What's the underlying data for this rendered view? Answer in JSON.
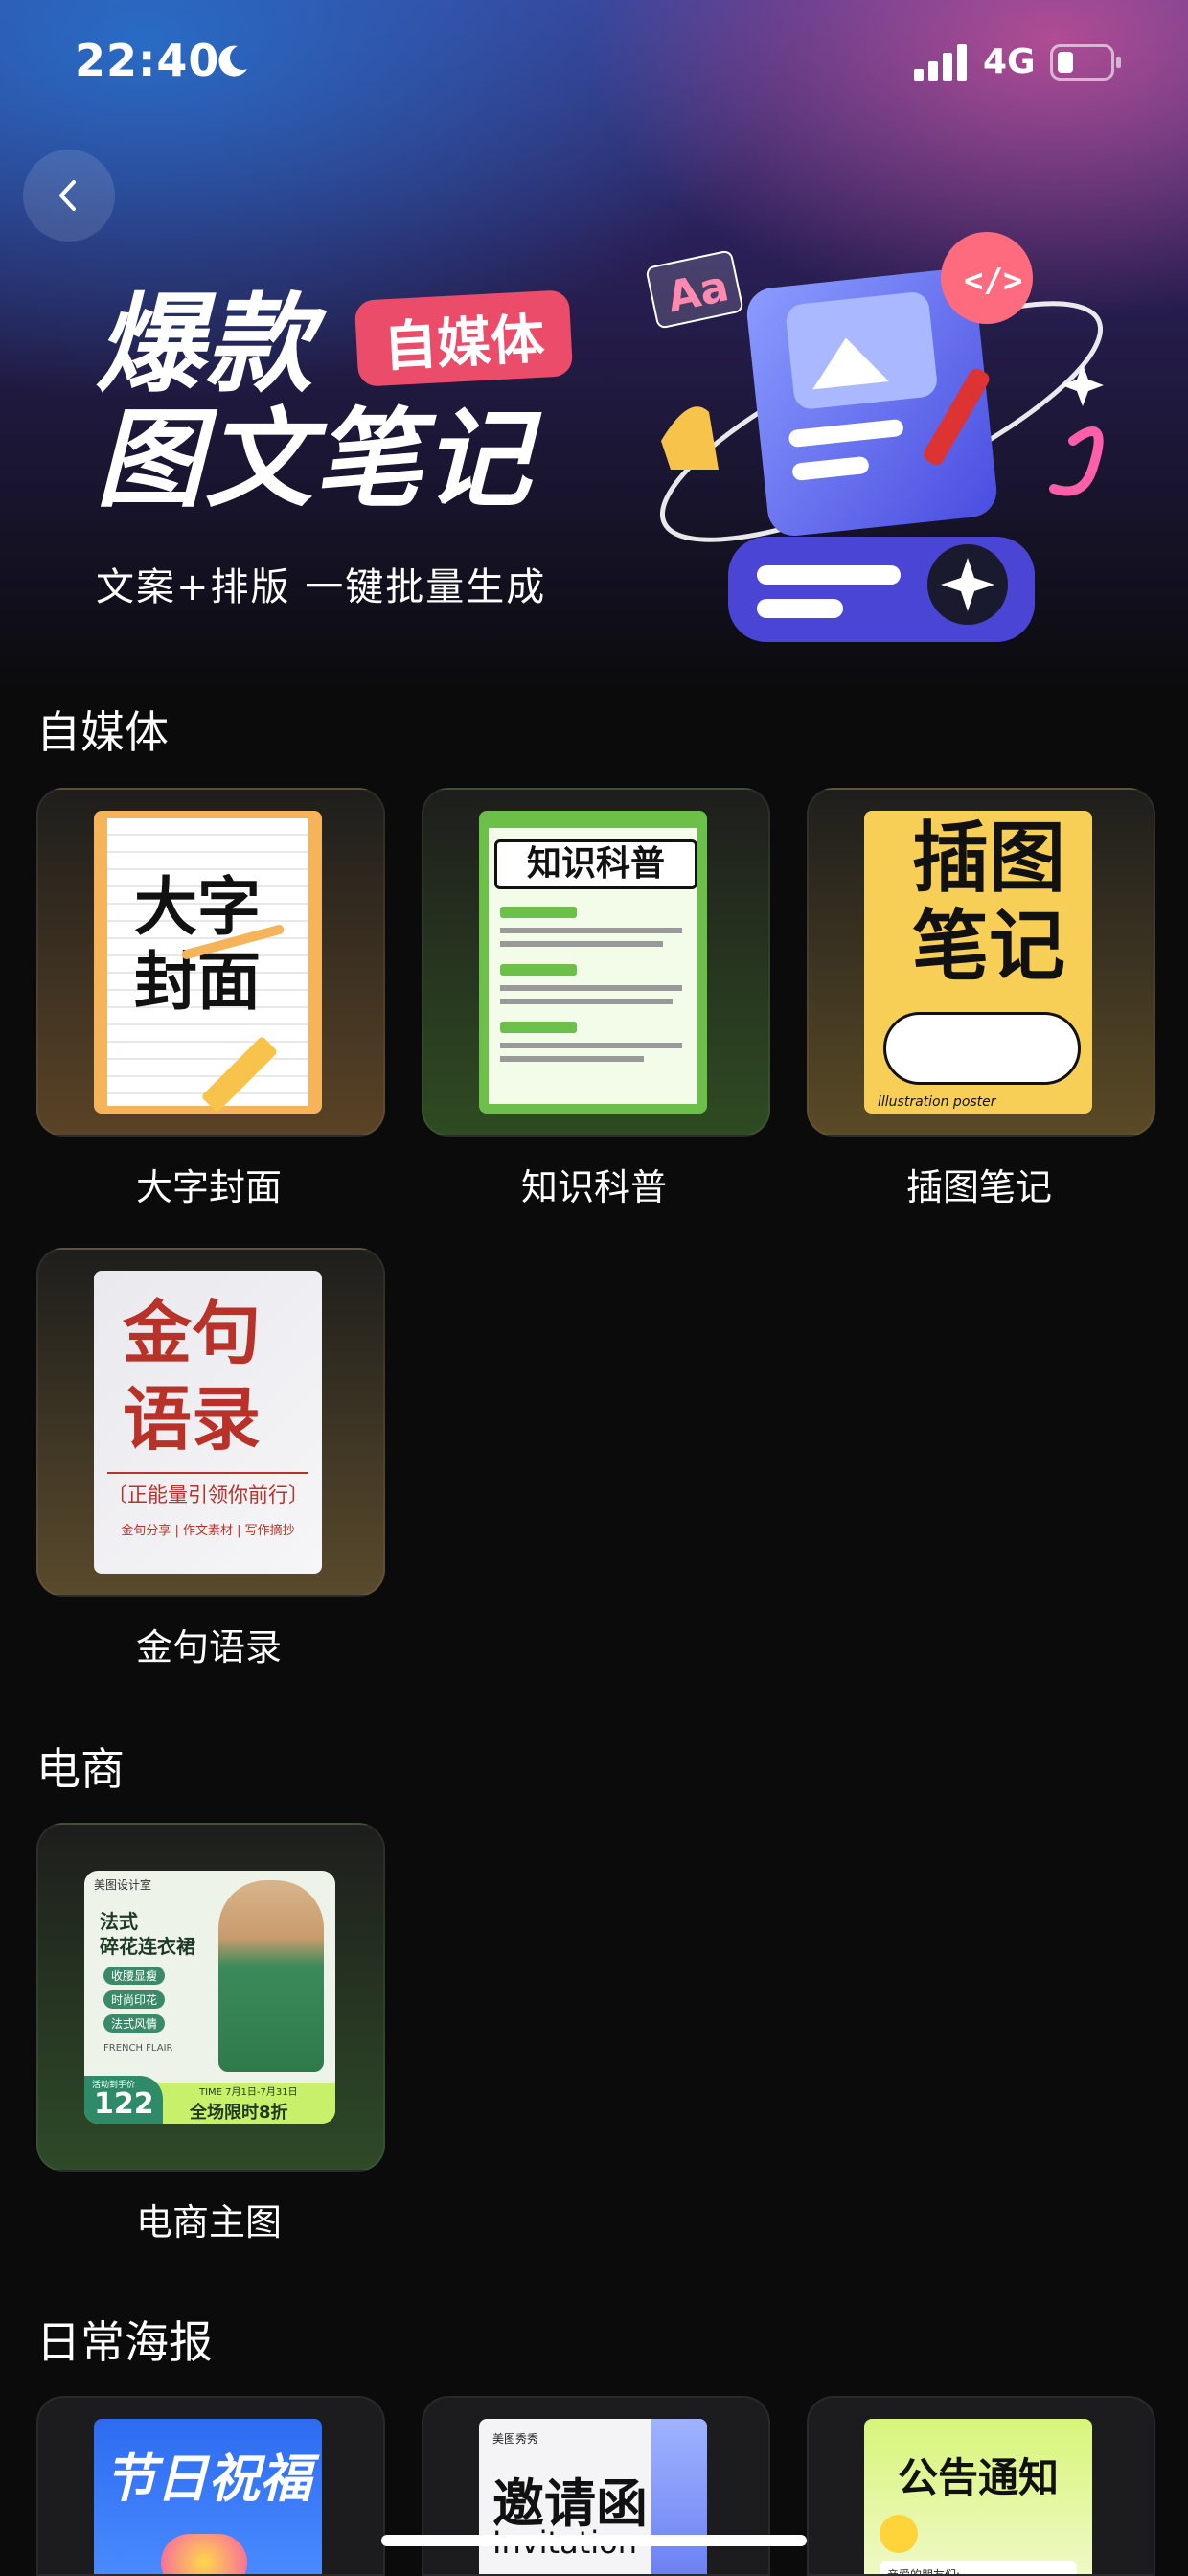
{
  "status_bar": {
    "time": "22:40",
    "network": "4G"
  },
  "banner": {
    "title_line1": "爆款",
    "title_line2": "图文笔记",
    "tag": "自媒体",
    "subtitle": "文案+排版 一键批量生成",
    "art_badge": "Aa"
  },
  "sections": [
    {
      "title": "自媒体",
      "cards": [
        {
          "label": "大字封面",
          "poster": {
            "line1": "大字",
            "line2": "封面"
          }
        },
        {
          "label": "知识科普",
          "poster": {
            "title": "知识科普"
          }
        },
        {
          "label": "插图笔记",
          "poster": {
            "line1": "插图",
            "line2": "笔记",
            "caption": "illustration poster"
          }
        },
        {
          "label": "金句语录",
          "poster": {
            "line1": "金句",
            "line2": "语录",
            "banner": "〔正能量引领你前行〕",
            "footer": "金句分享 | 作文素材 | 写作摘抄"
          }
        }
      ]
    },
    {
      "title": "电商",
      "cards": [
        {
          "label": "电商主图",
          "poster": {
            "brand": "美图设计室",
            "title1": "法式",
            "title2": "碎花连衣裙",
            "tags": [
              "收腰显瘦",
              "时尚印花",
              "法式风情"
            ],
            "small": "FRENCH FLAIR",
            "price_label": "活动到手价",
            "price": "122",
            "time": "TIME 7月1日-7月31日",
            "promo": "全场限时8折"
          }
        }
      ]
    },
    {
      "title": "日常海报",
      "cards": [
        {
          "poster": {
            "title": "节日祝福"
          }
        },
        {
          "poster": {
            "brand": "美图秀秀",
            "title": "邀请函",
            "sub": "Invitation"
          }
        },
        {
          "poster": {
            "title": "公告通知",
            "body": "亲爱的朋友们:"
          }
        }
      ]
    }
  ],
  "colors": {
    "accent_pink": "#ea4c6a",
    "background": "#0b0b0c"
  }
}
